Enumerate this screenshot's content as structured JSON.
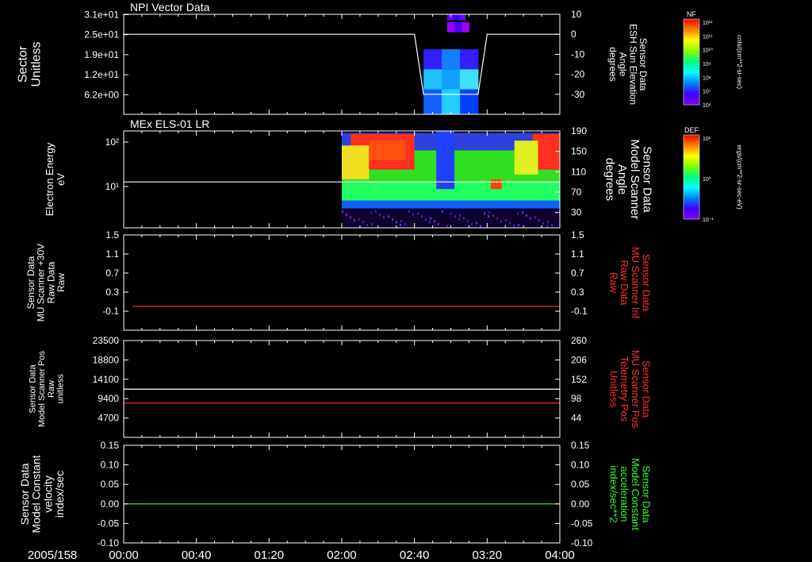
{
  "chart_data": [
    {
      "type": "heatmap",
      "title": "NPI Vector Data",
      "ylabel": "Sector\nUnitless",
      "y_ticks": [
        "3.1e+01",
        "2.5e+01",
        "1.9e+01",
        "1.2e+01",
        "6.2e+00"
      ],
      "y2label": "Sensor Data\nESH Sun Elevation\nAngle\ndegrees",
      "y2_ticks": [
        "10",
        "0",
        "-10",
        "-20",
        "-30"
      ],
      "y2lim": [
        -40,
        10
      ],
      "line_series": {
        "x": [
          "00:00",
          "02:00",
          "02:40",
          "02:45",
          "03:15",
          "03:20",
          "04:00"
        ],
        "values": [
          0,
          0,
          0,
          -30,
          -30,
          0,
          0
        ]
      },
      "colorbar": {
        "label": "NF",
        "units": "cnts/(cm**2-sr-sec)",
        "ticks": [
          "10^12",
          "10^11",
          "10^10",
          "10^9",
          "10^8",
          "10^7",
          "10^6"
        ]
      }
    },
    {
      "type": "heatmap",
      "title": "MEx ELS-01 LR",
      "ylabel": "Electron Energy\neV",
      "y_ticks": [
        "10^2",
        "10^1"
      ],
      "yscale": "log",
      "y2label": "Sensor Data\nModel Scanner\nAngle\ndegrees",
      "y2_ticks": [
        "190",
        "150",
        "110",
        "70",
        "30"
      ],
      "y2lim": [
        0,
        190
      ],
      "line_series": {
        "x": [
          "00:00",
          "04:00"
        ],
        "values": [
          90,
          90
        ]
      },
      "data_start": "02:00",
      "colorbar": {
        "label": "DEF",
        "units": "ergs/(cm**2-sr-sec-eV)",
        "ticks": [
          "10^1",
          "10^0",
          "10^-1"
        ]
      }
    },
    {
      "type": "line",
      "ylabel": "Sensor Data\nMU Scanner +30V\nRaw Data\nRaw",
      "y_ticks": [
        "1.5",
        "1.1",
        "0.7",
        "0.3",
        "-0.1"
      ],
      "ylim": [
        -0.5,
        1.5
      ],
      "y2label": "Sensor Data\nMU Scanner Inf\nRaw Data\nRaw",
      "y2_ticks": [
        "1.5",
        "1.1",
        "0.7",
        "0.3",
        "-0.1"
      ],
      "series": [
        {
          "color": "#ff3030",
          "x": [
            "00:05",
            "04:00"
          ],
          "values": [
            0.0,
            0.0
          ]
        }
      ]
    },
    {
      "type": "line",
      "ylabel": "Sensor Data\nModel Scanner Pos\nRaw\nunitless",
      "y_ticks": [
        "23500",
        "18800",
        "14100",
        "9400",
        "4700"
      ],
      "ylim": [
        0,
        23500
      ],
      "y2label": "Sensor Data\nMU Scanner Pos\nTelemetry Pos\nUnitless",
      "y2_ticks": [
        "260",
        "206",
        "152",
        "98",
        "44"
      ],
      "y2lim": [
        -10,
        260
      ],
      "series": [
        {
          "color": "#ffffff",
          "x": [
            "00:00",
            "04:00"
          ],
          "values": [
            11700,
            11700
          ]
        },
        {
          "color": "#ff3030",
          "x": [
            "00:00",
            "04:00"
          ],
          "values": [
            8300,
            8300
          ]
        }
      ]
    },
    {
      "type": "line",
      "ylabel": "Sensor Data\nModel Constant\nvelocity\nindex/sec",
      "y_ticks": [
        "0.15",
        "0.10",
        "0.05",
        "0.00",
        "-0.05",
        "-0.10"
      ],
      "ylim": [
        -0.1,
        0.15
      ],
      "y2label": "Sensor Data\nModel Constant\nacceleration\nindex/sec**2",
      "y2_ticks": [
        "0.15",
        "0.10",
        "0.05",
        "0.00",
        "-0.05",
        "-0.10"
      ],
      "series": [
        {
          "color": "#30ff30",
          "x": [
            "00:00",
            "04:00"
          ],
          "values": [
            0.0,
            0.0
          ]
        }
      ]
    }
  ],
  "x_axis": {
    "date": "2005/158",
    "ticks": [
      "00:00",
      "00:40",
      "01:20",
      "02:00",
      "02:40",
      "03:20",
      "04:00"
    ],
    "range": [
      "00:00",
      "04:00"
    ]
  },
  "colors": {
    "axis": "#ffffff",
    "red_label": "#ff3030",
    "green_label": "#30ff30",
    "background": "#000000"
  }
}
